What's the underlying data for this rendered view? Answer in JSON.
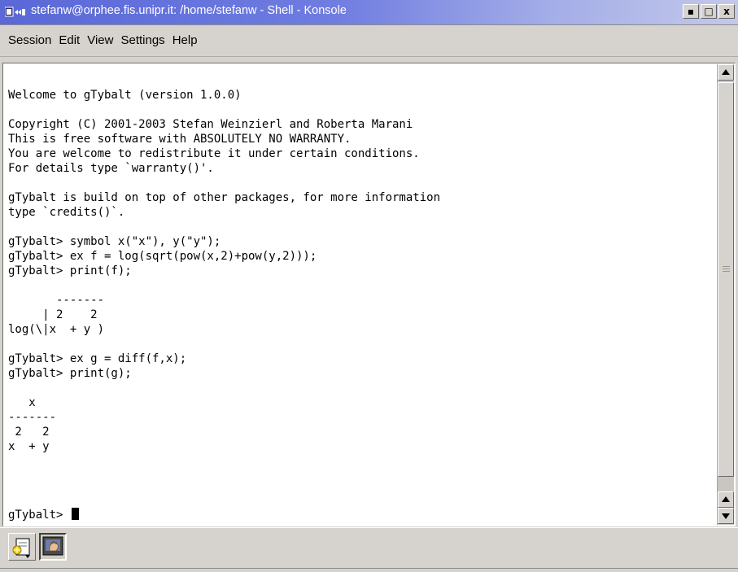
{
  "window": {
    "title": "stefanw@orphee.fis.unipr.it: /home/stefanw - Shell - Konsole",
    "buttons": {
      "minimize": "▪",
      "maximize": "□",
      "close": "x"
    }
  },
  "menu": {
    "items": [
      "Session",
      "Edit",
      "View",
      "Settings",
      "Help"
    ]
  },
  "terminal": {
    "lines": [
      "Welcome to gTybalt (version 1.0.0)",
      "",
      "Copyright (C) 2001-2003 Stefan Weinzierl and Roberta Marani",
      "This is free software with ABSOLUTELY NO WARRANTY.",
      "You are welcome to redistribute it under certain conditions.",
      "For details type `warranty()'.",
      "",
      "gTybalt is build on top of other packages, for more information",
      "type `credits()`.",
      "",
      "gTybalt> symbol x(\"x\"), y(\"y\");",
      "gTybalt> ex f = log(sqrt(pow(x,2)+pow(y,2)));",
      "gTybalt> print(f);",
      "",
      "       -------",
      "     | 2    2",
      "log(\\|x  + y )",
      "",
      "gTybalt> ex g = diff(f,x);",
      "gTybalt> print(g);",
      "",
      "   x",
      "-------",
      " 2   2",
      "x  + y",
      ""
    ],
    "prompt": "gTybalt> "
  },
  "tabs": {
    "items": [
      "new-session",
      "shell"
    ]
  },
  "colors": {
    "titlebar_start": "#5a68d8",
    "titlebar_end": "#c3c8ea",
    "chrome": "#d6d3ce",
    "terminal_bg": "#ffffff",
    "terminal_fg": "#000000"
  }
}
